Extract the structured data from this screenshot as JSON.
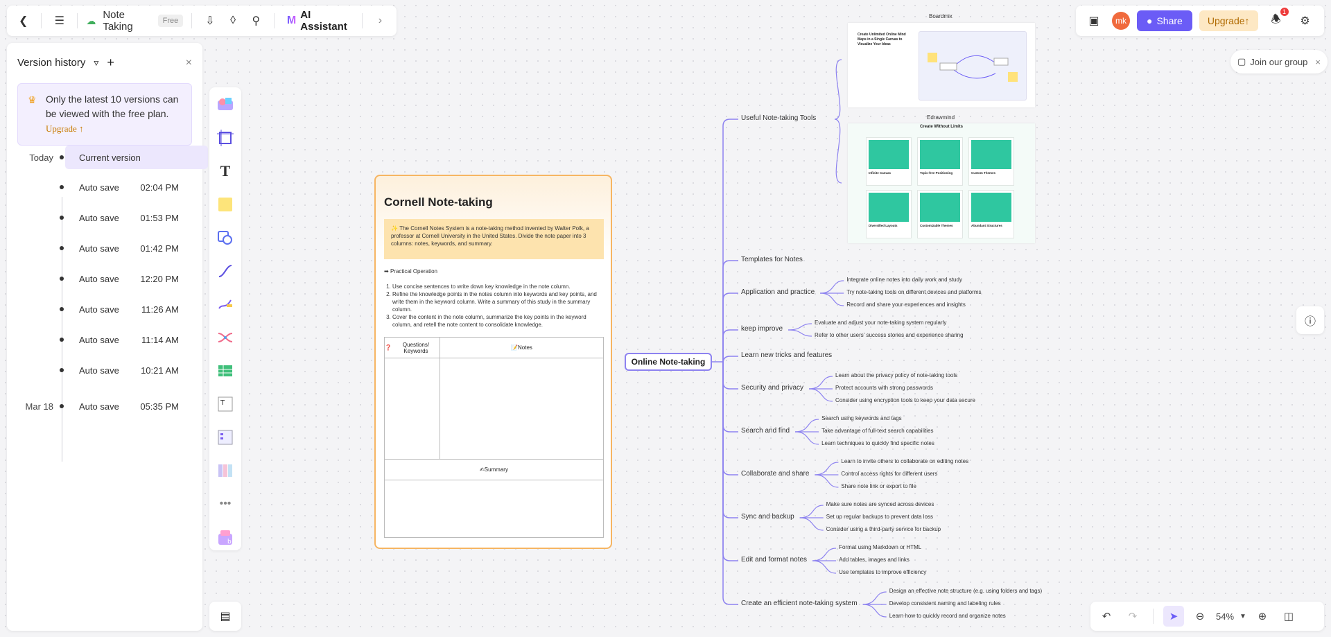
{
  "topbar": {
    "doc_title": "Note Taking",
    "plan_badge": "Free",
    "ai_label": "AI Assistant",
    "avatar_initials": "mk",
    "share_label": "Share",
    "upgrade_label": "Upgrade",
    "notif_count": "1",
    "join_group": "Join our group"
  },
  "version_history": {
    "title": "Version history",
    "note": "Only the latest 10 versions can be viewed with the free plan.",
    "upgrade_link": "Upgrade",
    "groups": [
      {
        "day": "Today",
        "items": [
          {
            "label": "Current version",
            "time": ""
          },
          {
            "label": "Auto save",
            "time": "02:04 PM"
          },
          {
            "label": "Auto save",
            "time": "01:53 PM"
          },
          {
            "label": "Auto save",
            "time": "01:42 PM"
          },
          {
            "label": "Auto save",
            "time": "12:20 PM"
          },
          {
            "label": "Auto save",
            "time": "11:26 AM"
          },
          {
            "label": "Auto save",
            "time": "11:14 AM"
          },
          {
            "label": "Auto save",
            "time": "10:21 AM"
          }
        ]
      },
      {
        "day": "Mar 18",
        "items": [
          {
            "label": "Auto save",
            "time": "05:35 PM"
          }
        ]
      }
    ]
  },
  "zoom": "54%",
  "cornell": {
    "title": "Cornell Note-taking",
    "intro": "The Cornell Notes System is a note-taking method invented by Walter Polk, a professor at Cornell University in the United States. Divide the note paper into 3 columns: notes, keywords, and summary.",
    "op_label": "Practical Operation",
    "steps": [
      "Use concise sentences to write down key knowledge in the note column.",
      "Refine the knowledge points in the notes column into keywords and key points, and write them in the keyword column. Write a summary of this study in the summary column.",
      "Cover the content in the note column, summarize the key points in the keyword column, and retell the note content to consolidate knowledge."
    ],
    "col_keywords": "Questions/ Keywords",
    "col_notes": "Notes",
    "summary": "Summary"
  },
  "mindmap": {
    "root": "Online Note-taking",
    "branches": [
      {
        "label": "Useful Note-taking Tools",
        "children": []
      },
      {
        "label": "Templates for Notes",
        "children": []
      },
      {
        "label": "Application and practice",
        "children": [
          "Integrate online notes into daily work and study",
          "Try note-taking tools on different devices and platforms",
          "Record and share your experiences and insights"
        ]
      },
      {
        "label": "keep improve",
        "children": [
          "Evaluate and adjust your note-taking system regularly",
          "Refer to other users' success stories and experience sharing"
        ]
      },
      {
        "label": "Learn new tricks and features",
        "children": []
      },
      {
        "label": "Security and privacy",
        "children": [
          "Learn about the privacy policy of note-taking tools",
          "Protect accounts with strong passwords",
          "Consider using encryption tools to keep your data secure"
        ]
      },
      {
        "label": "Search and find",
        "children": [
          "Search using keywords and tags",
          "Take advantage of full-text search capabilities",
          "Learn techniques to quickly find specific notes"
        ]
      },
      {
        "label": "Collaborate and share",
        "children": [
          "Learn to invite others to collaborate on editing notes",
          "Control access rights for different users",
          "Share note link or export to file"
        ]
      },
      {
        "label": "Sync and backup",
        "children": [
          "Make sure notes are synced across devices",
          "Set up regular backups to prevent data loss",
          "Consider using a third-party service for backup"
        ]
      },
      {
        "label": "Edit and format notes",
        "children": [
          "Format using Markdown or HTML",
          "Add tables, images and links",
          "Use templates to improve efficiency"
        ]
      },
      {
        "label": "Create an efficient note-taking system",
        "children": [
          "Design an effective note structure (e.g. using folders and tags)",
          "Develop consistent naming and labeling rules",
          "Learn how to quickly record and organize notes"
        ]
      }
    ],
    "image_captions": [
      "Boardmix",
      "Edrawmind"
    ],
    "boardmix_card_title": "Create Unlimited Online Mind Maps in a Single Canvas to Visualize Your Ideas",
    "edraw_card_title": "Create Without Limits",
    "edraw_tiles": [
      "Infinite Canvas",
      "Topic-free Positioning",
      "Custom Themes",
      "Diversified Layouts",
      "Customizable Themes",
      "Abundant Structures"
    ]
  },
  "colors": {
    "accent": "#6b5cf6",
    "branch_line": "#8d82f0",
    "card_border": "#f6b562"
  }
}
